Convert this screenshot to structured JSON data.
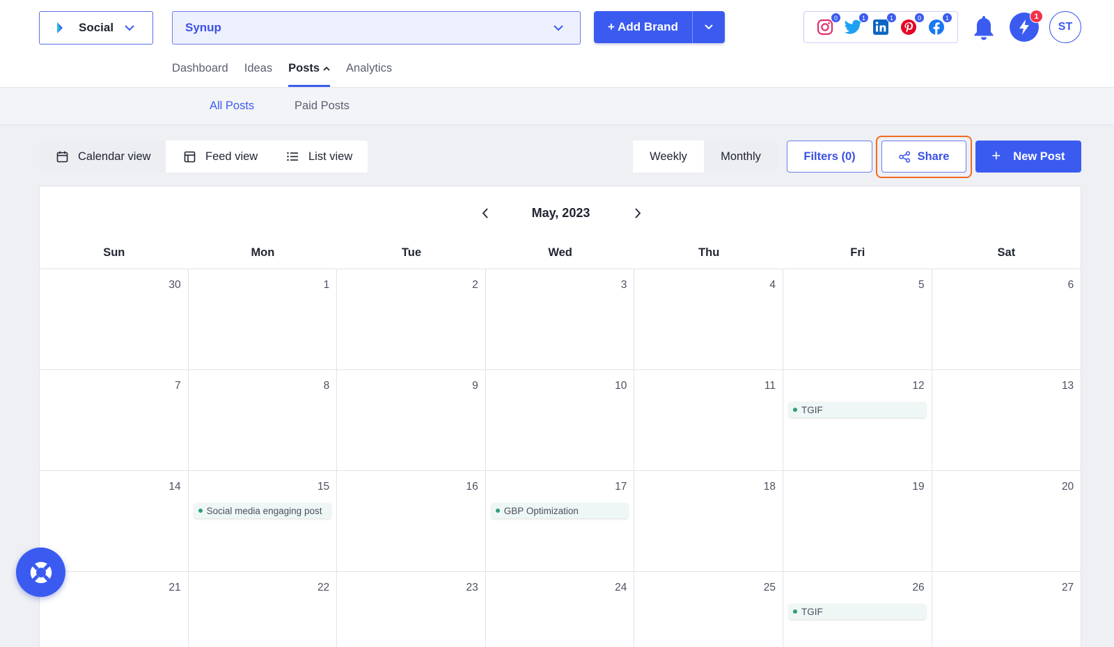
{
  "header": {
    "product": {
      "label": "Social"
    },
    "brand_select": {
      "label": "Synup"
    },
    "add_brand": {
      "label": "+ Add Brand"
    },
    "social_accounts": [
      {
        "icon": "instagram-icon",
        "count": "0",
        "color": "#e1306c"
      },
      {
        "icon": "twitter-icon",
        "count": "1",
        "color": "#1da1f2"
      },
      {
        "icon": "linkedin-icon",
        "count": "1",
        "color": "#0a66c2"
      },
      {
        "icon": "pinterest-icon",
        "count": "0",
        "color": "#e60023"
      },
      {
        "icon": "facebook-icon",
        "count": "1",
        "color": "#1877f2"
      }
    ],
    "activity_badge": "1",
    "avatar_initials": "ST"
  },
  "main_nav": {
    "items": [
      {
        "label": "Dashboard"
      },
      {
        "label": "Ideas"
      },
      {
        "label": "Posts",
        "active": true
      },
      {
        "label": "Analytics"
      }
    ]
  },
  "sub_nav": {
    "items": [
      {
        "label": "All Posts",
        "active": true
      },
      {
        "label": "Paid Posts"
      }
    ]
  },
  "toolbar": {
    "views": [
      {
        "label": "Calendar view",
        "icon": "calendar-icon",
        "active": true
      },
      {
        "label": "Feed view",
        "icon": "feed-icon"
      },
      {
        "label": "List view",
        "icon": "list-icon"
      }
    ],
    "periods": [
      {
        "label": "Weekly"
      },
      {
        "label": "Monthly"
      }
    ],
    "filters_label": "Filters (0)",
    "share_label": "Share",
    "new_post_label": "New Post"
  },
  "calendar": {
    "title": "May, 2023",
    "weekdays": [
      "Sun",
      "Mon",
      "Tue",
      "Wed",
      "Thu",
      "Fri",
      "Sat"
    ],
    "weeks": [
      [
        "30",
        "1",
        "2",
        "3",
        "4",
        "5",
        "6"
      ],
      [
        "7",
        "8",
        "9",
        "10",
        "11",
        "12",
        "13"
      ],
      [
        "14",
        "15",
        "16",
        "17",
        "18",
        "19",
        "20"
      ],
      [
        "21",
        "22",
        "23",
        "24",
        "25",
        "26",
        "27"
      ]
    ],
    "events": [
      {
        "week": 1,
        "day": 5,
        "label": "TGIF"
      },
      {
        "week": 2,
        "day": 1,
        "label": "Social media engaging post"
      },
      {
        "week": 2,
        "day": 3,
        "label": "GBP Optimization"
      },
      {
        "week": 3,
        "day": 5,
        "label": "TGIF"
      }
    ]
  },
  "colors": {
    "accent": "#3b5bf0",
    "highlight": "#f06a1e",
    "event_dot": "#2e9e7a",
    "notification": "#f0344a"
  }
}
